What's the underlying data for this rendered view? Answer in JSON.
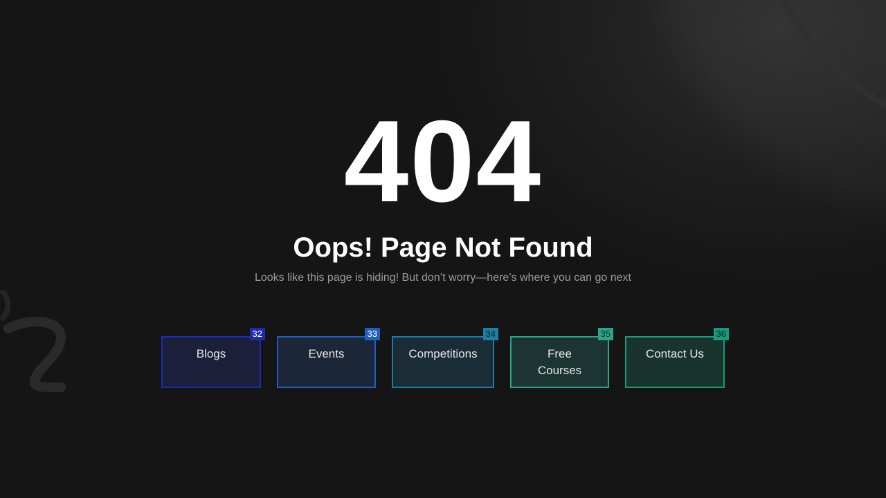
{
  "error": {
    "code": "404",
    "title": "Oops! Page Not Found",
    "message": "Looks like this page is hiding! But don’t worry—here’s where you can go next"
  },
  "nav": {
    "buttons": [
      {
        "label": "Blogs",
        "badge": "32",
        "accent": "#1a2bb5"
      },
      {
        "label": "Events",
        "badge": "33",
        "accent": "#1e5fbf"
      },
      {
        "label": "Competitions",
        "badge": "34",
        "accent": "#1a7fa6"
      },
      {
        "label": "Free Courses",
        "badge": "35",
        "accent": "#2aa58a"
      },
      {
        "label": "Contact Us",
        "badge": "36",
        "accent": "#159c7a"
      }
    ]
  },
  "colors": {
    "background": "#151515",
    "heading": "#ffffff",
    "subtext": "#9b9b9b"
  },
  "decorations": [
    "ring-shape",
    "squiggle-shape"
  ]
}
